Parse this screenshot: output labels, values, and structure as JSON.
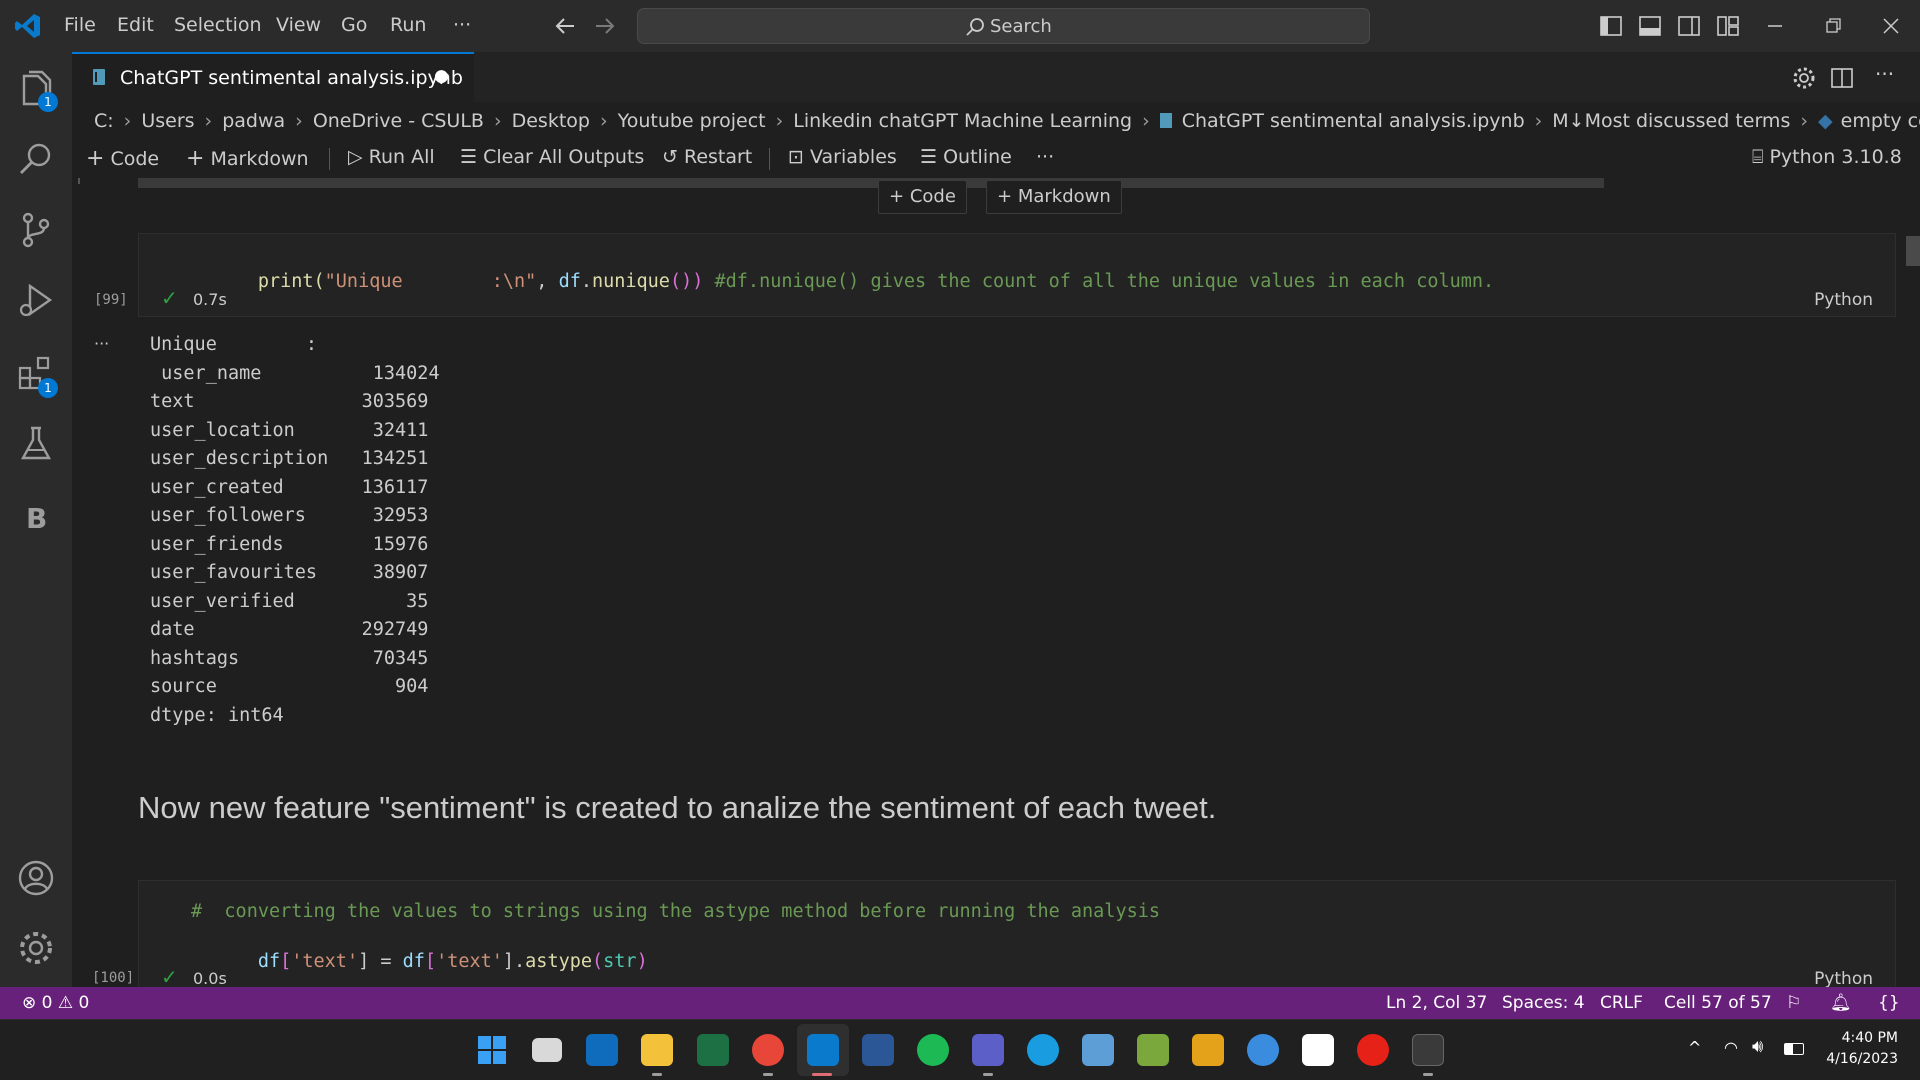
{
  "titlebar": {
    "menus": [
      "File",
      "Edit",
      "Selection",
      "View",
      "Go",
      "Run",
      "···"
    ],
    "search_label": "Search"
  },
  "activity_bar": {
    "explorer_badge": "1",
    "extensions_badge": "1",
    "b_label": "B"
  },
  "tab": {
    "title": "ChatGPT sentimental analysis.ipynb",
    "dirty_dot": "●"
  },
  "breadcrumb": [
    "C:",
    "Users",
    "padwa",
    "OneDrive - CSULB",
    "Desktop",
    "Youtube project",
    "Linkedin chatGPT Machine Learning",
    "ChatGPT sentimental analysis.ipynb",
    "M↓Most discussed terms",
    "empty cell"
  ],
  "toolbar": {
    "code": "Code",
    "markdown": "Markdown",
    "run_all": "Run All",
    "clear_outputs": "Clear All Outputs",
    "restart": "Restart",
    "variables": "Variables",
    "outline": "Outline",
    "more": "···",
    "kernel": "Python 3.10.8"
  },
  "insert_bar": {
    "code": "Code",
    "markdown": "Markdown"
  },
  "cell99": {
    "code_parts": [
      "print(",
      "\"Unique        :\\n\"",
      ", ",
      "df",
      ".",
      "nunique",
      "()) ",
      "#df.nunique() gives the count of all the unique values in each column."
    ],
    "exec_count": "[99]",
    "timing": "0.7s",
    "language": "Python",
    "output_dots": "···",
    "output": [
      "Unique        :",
      " user_name          134024",
      "text               303569",
      "user_location       32411",
      "user_description   134251",
      "user_created       136117",
      "user_followers      32953",
      "user_friends        15976",
      "user_favourites     38907",
      "user_verified          35",
      "date               292749",
      "hashtags            70345",
      "source                904",
      "dtype: int64"
    ]
  },
  "markdown_cell": {
    "text": "Now new feature \"sentiment\" is created to analize the sentiment of each tweet."
  },
  "cell100": {
    "comment": "#  converting the values to strings using the astype method before running the analysis",
    "line2_parts": [
      "df",
      "[",
      "'text'",
      "] = ",
      "df",
      "[",
      "'text'",
      "].",
      "astype",
      "(",
      "str",
      ")"
    ],
    "exec_count": "[100]",
    "timing": "0.0s",
    "language": "Python"
  },
  "statusbar": {
    "errors": "0",
    "warnings": "0",
    "position": "Ln 2, Col 37",
    "spaces": "Spaces: 4",
    "eol": "CRLF",
    "cell": "Cell 57 of 57"
  },
  "taskbar": {
    "time": "4:40 PM",
    "date": "4/16/2023",
    "caret": "^"
  },
  "colors": {
    "accent": "#0078d4",
    "statusbar": "#68217a",
    "string": "#ce9178",
    "function": "#dcdcaa",
    "variable": "#9cdcfe",
    "comment": "#6a9955",
    "success": "#2ea043"
  }
}
